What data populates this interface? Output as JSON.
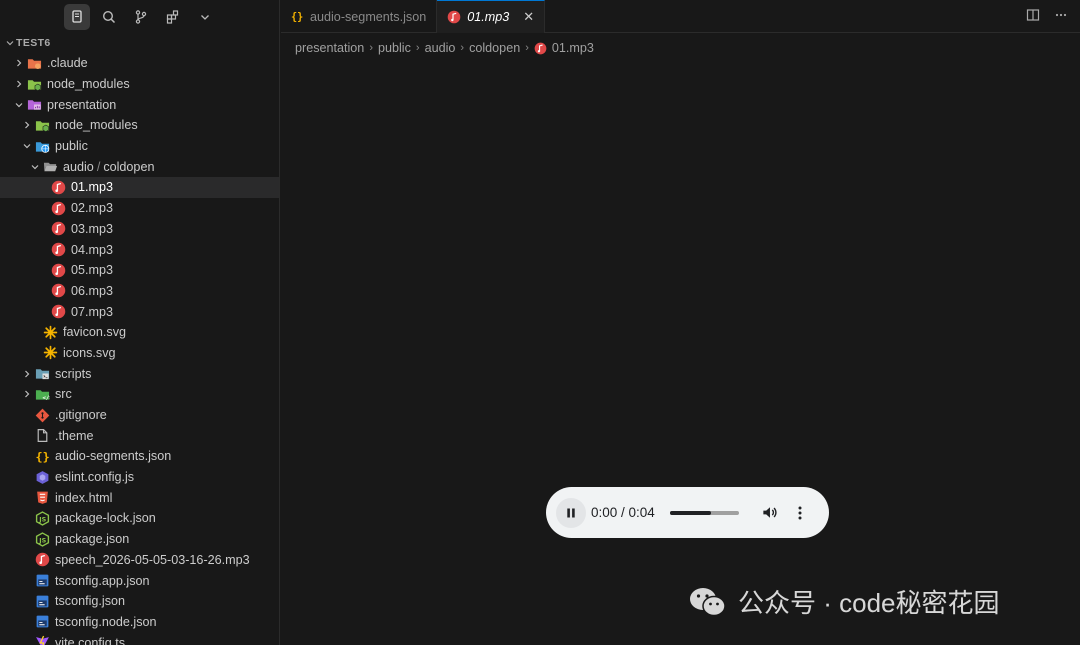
{
  "sidebar": {
    "section_title": "TEST6",
    "tree": [
      {
        "label": ".claude",
        "depth": 1,
        "chevron": "right",
        "icon": "folder-claude-icon",
        "color": "#e8734a"
      },
      {
        "label": "node_modules",
        "depth": 1,
        "chevron": "right",
        "icon": "folder-node-icon",
        "color": "#8bc34a"
      },
      {
        "label": "presentation",
        "depth": 1,
        "chevron": "down",
        "icon": "folder-presentation-icon",
        "color": "#b565d9"
      },
      {
        "label": "node_modules",
        "depth": 2,
        "chevron": "right",
        "icon": "folder-node-icon",
        "color": "#8bc34a"
      },
      {
        "label": "public",
        "depth": 2,
        "chevron": "down",
        "icon": "folder-public-icon",
        "color": "#3a9ad9"
      },
      {
        "label": "audio",
        "label2": "coldopen",
        "depth": 3,
        "chevron": "down",
        "icon": "folder-open-icon",
        "color": "#909090"
      },
      {
        "label": "01.mp3",
        "depth": 4,
        "chevron": "none",
        "icon": "audio-file-icon",
        "color": "#e04848",
        "selected": true
      },
      {
        "label": "02.mp3",
        "depth": 4,
        "chevron": "none",
        "icon": "audio-file-icon",
        "color": "#e04848"
      },
      {
        "label": "03.mp3",
        "depth": 4,
        "chevron": "none",
        "icon": "audio-file-icon",
        "color": "#e04848"
      },
      {
        "label": "04.mp3",
        "depth": 4,
        "chevron": "none",
        "icon": "audio-file-icon",
        "color": "#e04848"
      },
      {
        "label": "05.mp3",
        "depth": 4,
        "chevron": "none",
        "icon": "audio-file-icon",
        "color": "#e04848"
      },
      {
        "label": "06.mp3",
        "depth": 4,
        "chevron": "none",
        "icon": "audio-file-icon",
        "color": "#e04848"
      },
      {
        "label": "07.mp3",
        "depth": 4,
        "chevron": "none",
        "icon": "audio-file-icon",
        "color": "#e04848"
      },
      {
        "label": "favicon.svg",
        "depth": 3,
        "chevron": "none",
        "icon": "svg-file-icon",
        "color": "#f5b400"
      },
      {
        "label": "icons.svg",
        "depth": 3,
        "chevron": "none",
        "icon": "svg-file-icon",
        "color": "#f5b400"
      },
      {
        "label": "scripts",
        "depth": 2,
        "chevron": "right",
        "icon": "folder-scripts-icon",
        "color": "#6a9fb5"
      },
      {
        "label": "src",
        "depth": 2,
        "chevron": "right",
        "icon": "folder-src-icon",
        "color": "#4caf50"
      },
      {
        "label": ".gitignore",
        "depth": 2,
        "chevron": "none",
        "icon": "git-icon",
        "color": "#e8573f"
      },
      {
        "label": ".theme",
        "depth": 2,
        "chevron": "none",
        "icon": "file-icon",
        "color": "#bbbbbb"
      },
      {
        "label": "audio-segments.json",
        "depth": 2,
        "chevron": "none",
        "icon": "json-icon",
        "color": "#f5b400"
      },
      {
        "label": "eslint.config.js",
        "depth": 2,
        "chevron": "none",
        "icon": "eslint-icon",
        "color": "#6b61d6"
      },
      {
        "label": "index.html",
        "depth": 2,
        "chevron": "none",
        "icon": "html-icon",
        "color": "#e8573f"
      },
      {
        "label": "package-lock.json",
        "depth": 2,
        "chevron": "none",
        "icon": "nodejs-icon",
        "color": "#8bc34a"
      },
      {
        "label": "package.json",
        "depth": 2,
        "chevron": "none",
        "icon": "nodejs-icon",
        "color": "#8bc34a"
      },
      {
        "label": "speech_2026-05-05-03-16-26.mp3",
        "depth": 2,
        "chevron": "none",
        "icon": "audio-file-icon",
        "color": "#e04848"
      },
      {
        "label": "tsconfig.app.json",
        "depth": 2,
        "chevron": "none",
        "icon": "tsconfig-icon",
        "color": "#3a7fd9"
      },
      {
        "label": "tsconfig.json",
        "depth": 2,
        "chevron": "none",
        "icon": "tsconfig-icon",
        "color": "#3a7fd9"
      },
      {
        "label": "tsconfig.node.json",
        "depth": 2,
        "chevron": "none",
        "icon": "tsconfig-icon",
        "color": "#3a7fd9"
      },
      {
        "label": "vite.config.ts",
        "depth": 2,
        "chevron": "none",
        "icon": "vite-icon",
        "color": "#a259ff"
      }
    ]
  },
  "tabs": [
    {
      "label": "audio-segments.json",
      "icon": "json-icon",
      "active": false
    },
    {
      "label": "01.mp3",
      "icon": "audio-file-icon",
      "active": true,
      "close": "✕"
    }
  ],
  "breadcrumb": [
    "presentation",
    "public",
    "audio",
    "coldopen",
    "01.mp3"
  ],
  "player": {
    "time": "0:00 / 0:04",
    "progress": 0.6
  },
  "watermark": {
    "text": "公众号 · code秘密花园"
  },
  "colors": {
    "accent": "#0078d4",
    "audio_icon": "#e04848",
    "json_icon": "#f5b400"
  }
}
